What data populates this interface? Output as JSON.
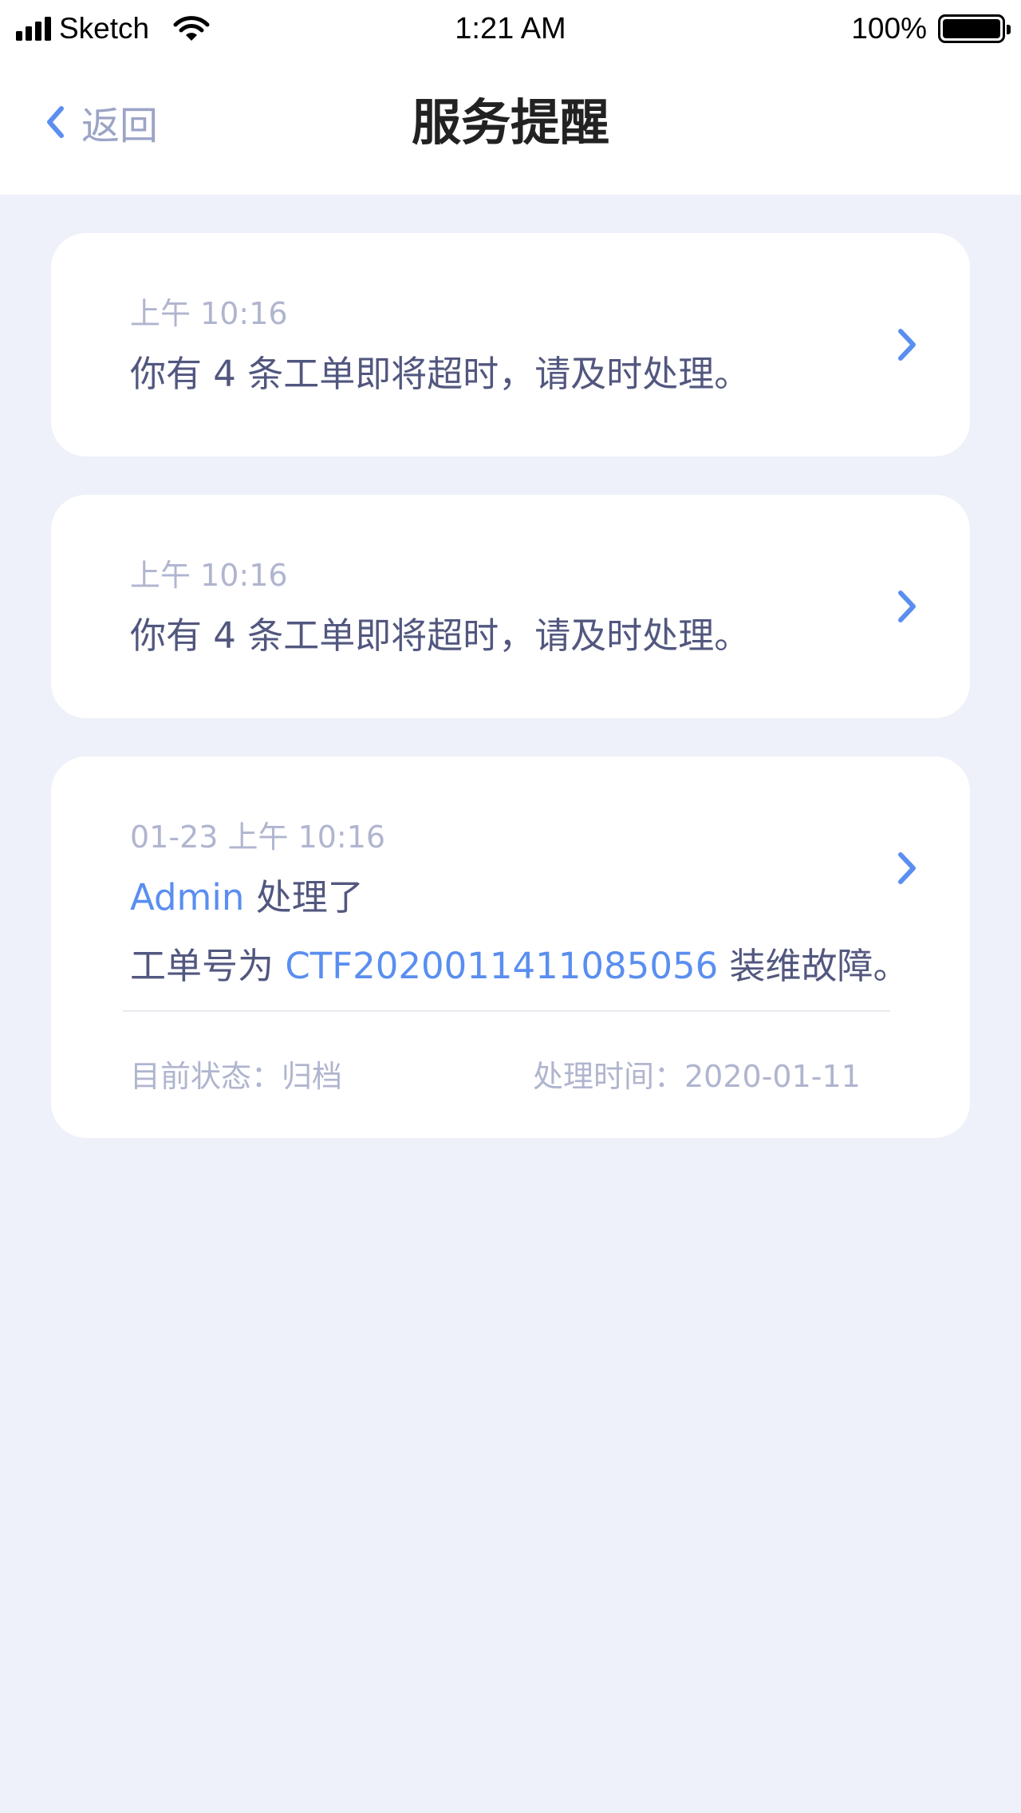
{
  "status_bar": {
    "carrier": "Sketch",
    "time": "1:21 AM",
    "battery": "100%"
  },
  "nav": {
    "back_label": "返回",
    "title": "服务提醒"
  },
  "cards": [
    {
      "time": "上午 10:16",
      "message": "你有 4 条工单即将超时，请及时处理。"
    },
    {
      "time": "上午 10:16",
      "message": "你有 4 条工单即将超时，请及时处理。"
    },
    {
      "time": "01-23  上午 10:16",
      "user": "Admin",
      "action": "处理了",
      "order_prefix": "工单号为",
      "order_no": "CTF2020011411085056",
      "order_suffix": "装维故障。",
      "status_label": "目前状态：归档",
      "handle_time": "处理时间：2020-01-11"
    }
  ],
  "colors": {
    "accent": "#5a8ef0",
    "background": "#eef1f9",
    "text": "#52577f",
    "muted": "#b0b5cf"
  },
  "icons": [
    "signal-icon",
    "wifi-icon",
    "battery-icon",
    "chevron-left-icon",
    "chevron-right-icon"
  ]
}
